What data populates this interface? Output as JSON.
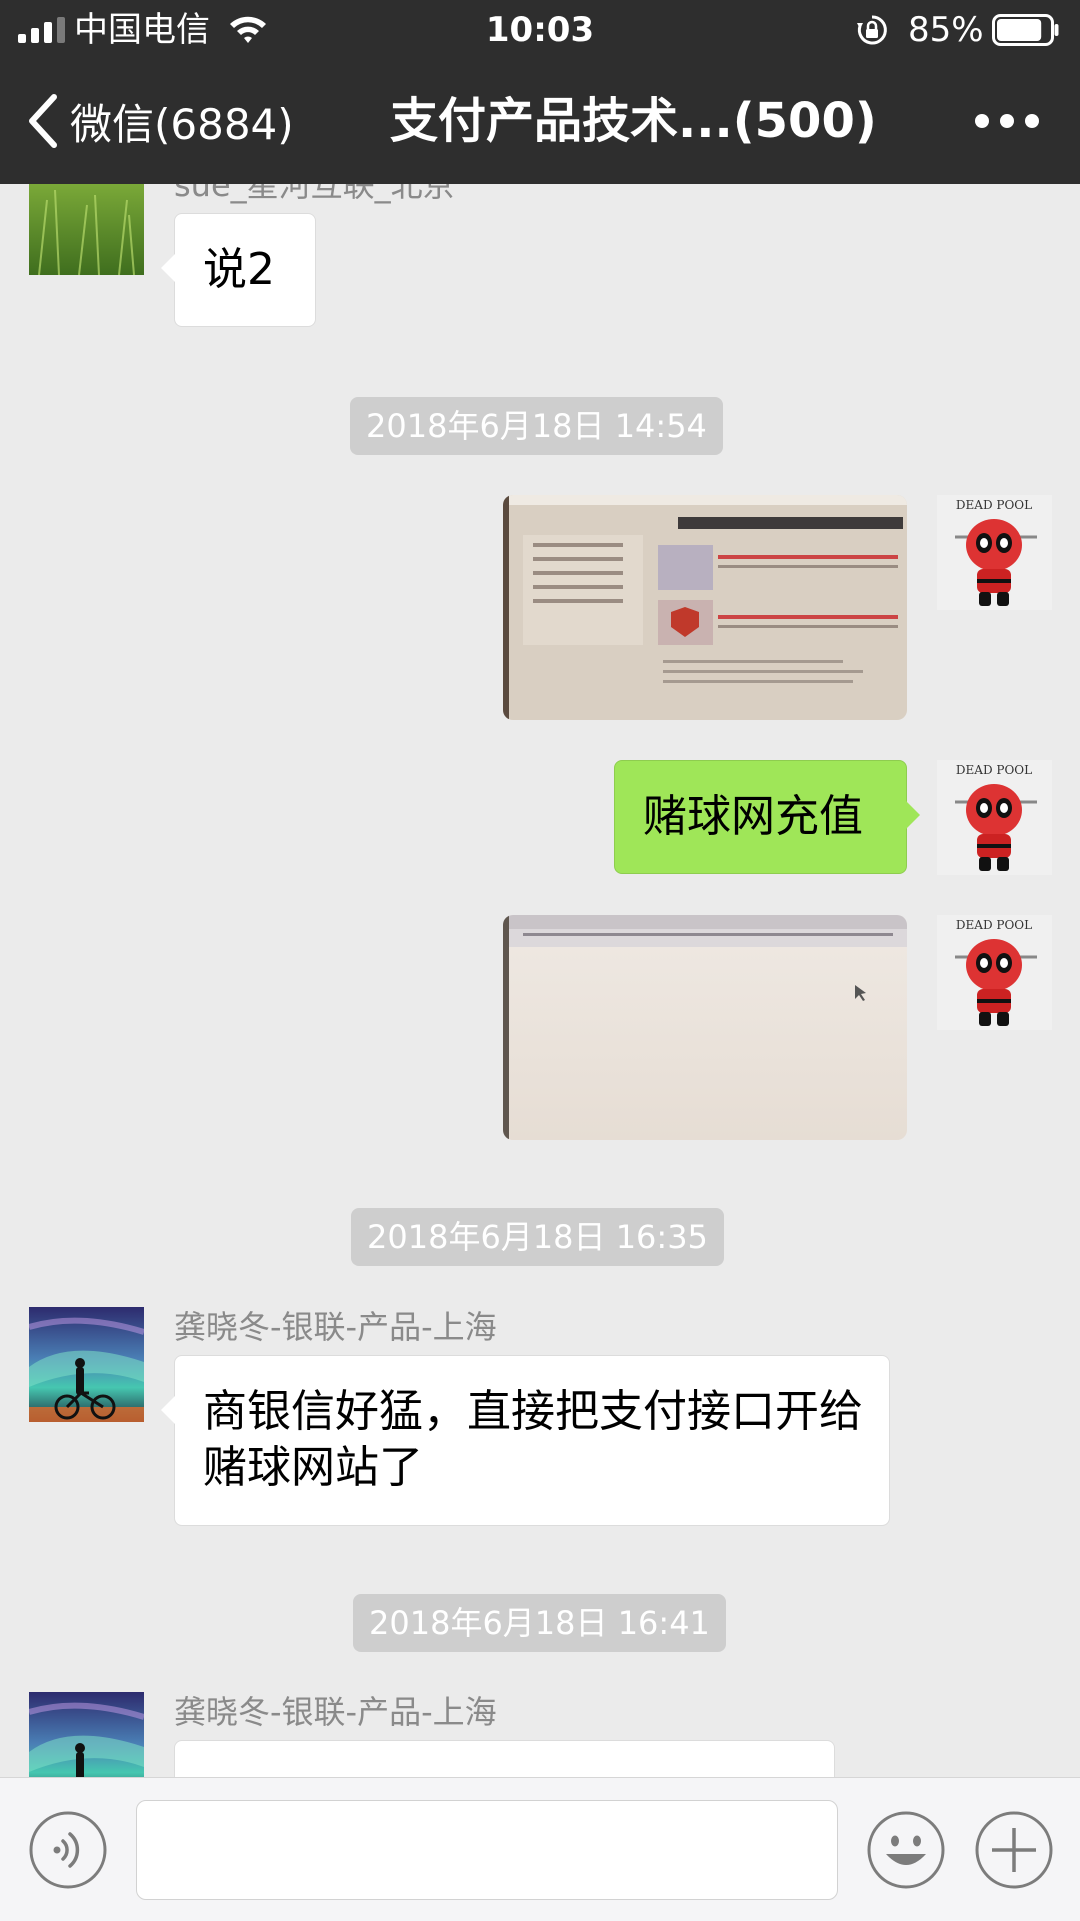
{
  "status_bar": {
    "carrier": "中国电信",
    "time": "10:03",
    "battery_percent": "85%",
    "battery_level": 0.85
  },
  "nav": {
    "back_label": "微信(6884)",
    "title": "支付产品技术...(500)",
    "icons": {
      "back": "chevron-left-icon",
      "more": "more-dots-icon"
    }
  },
  "chat": {
    "messages": [
      {
        "type": "text",
        "side": "left",
        "sender": "sue_星河互联_北京",
        "text": "说2"
      },
      {
        "type": "timestamp",
        "text": "2018年6月18日 14:54"
      },
      {
        "type": "image",
        "side": "right"
      },
      {
        "type": "text",
        "side": "right",
        "text": "赌球网充值"
      },
      {
        "type": "image",
        "side": "right"
      },
      {
        "type": "timestamp",
        "text": "2018年6月18日 16:35"
      },
      {
        "type": "text",
        "side": "left",
        "sender": "龚晓冬-银联-产品-上海",
        "text": "商银信好猛，直接把支付接口开给赌球网站了"
      },
      {
        "type": "timestamp",
        "text": "2018年6月18日 16:41"
      },
      {
        "type": "text",
        "side": "left",
        "sender": "龚晓冬-银联-产品-上海",
        "text": ""
      }
    ]
  },
  "input_bar": {
    "icons": {
      "voice": "voice-icon",
      "emoji": "emoji-icon",
      "plus": "plus-icon"
    },
    "placeholder": ""
  },
  "colors": {
    "nav_background": "#2e2e2e",
    "chat_background": "#ebebeb",
    "own_bubble": "#9fe658",
    "other_bubble": "#ffffff",
    "timestamp_pill": "#cecece"
  }
}
